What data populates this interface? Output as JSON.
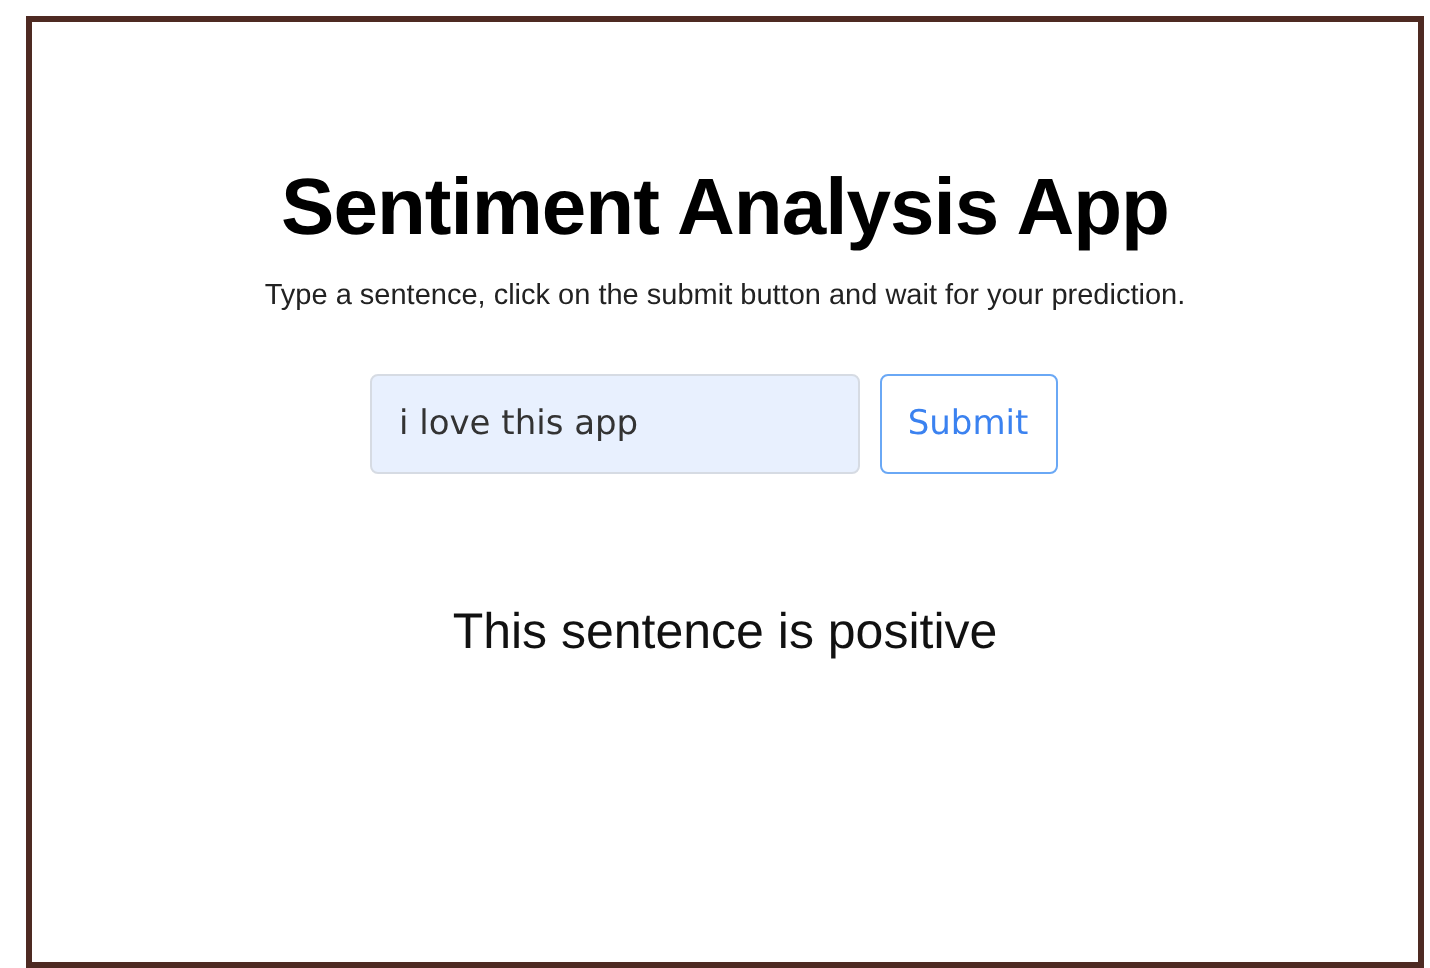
{
  "title": "Sentiment Analysis App",
  "subtitle": "Type a sentence, click on the submit button and wait for your prediction.",
  "input": {
    "value": "i love this app"
  },
  "submit_button": "Submit",
  "result": "This sentence is positive"
}
